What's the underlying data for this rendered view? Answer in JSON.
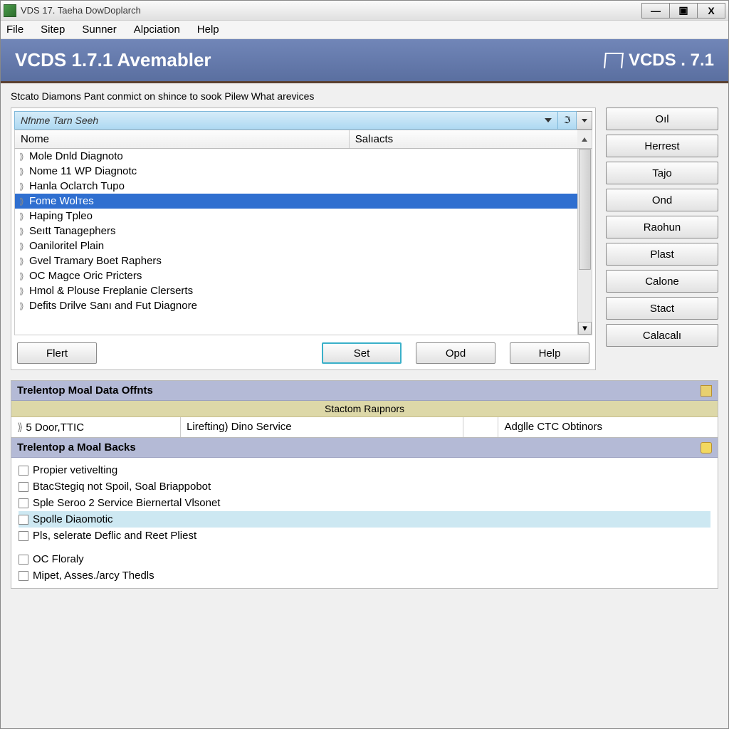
{
  "titlebar": {
    "text": "VDS 17. Taeha DowDoplarch"
  },
  "menubar": {
    "items": [
      "File",
      "Sitep",
      "Sunner",
      "Alpciation",
      "Help"
    ]
  },
  "header": {
    "title": "VCDS 1.7.1 Avemabler",
    "right": "VCDS . 7.1"
  },
  "instruction": "Stcato Diamons Pant conmict on shince to sook Pilew What arevices",
  "dropdown": {
    "text": "Nfnme Tarn Seeh",
    "extra": "ℑ"
  },
  "list": {
    "headers": {
      "c1": "Nome",
      "c2": "Salıacts"
    },
    "items": [
      "Mole Dnld Diagnoto",
      "Nome 11 WP Diagnotc",
      "Hanla Oclатсh Tupo",
      "Fome Wolтes",
      "Haping Tpleo",
      "Seıtt Tanageрhers",
      "Oaniloritel Plain",
      "Gvel Tramary Boet Raphers",
      "OC Magсe Oric Priсters",
      "Hmol & Plouse Freplanie Clerserts",
      "Defits Drilve Sanı and Fut Diagnоre"
    ],
    "selectedIndex": 3
  },
  "buttons": {
    "flert": "Flert",
    "set": "Set",
    "opd": "Opd",
    "help": "Help"
  },
  "side_buttons": [
    "Oıl",
    "Herrest",
    "Tajo",
    "Ond",
    "Raohun",
    "Plast",
    "Calone",
    "Stact",
    "Calaсalı"
  ],
  "panel1": {
    "title": "Trelentop Moal Data Offnts",
    "sub": "Stactom Raıpnors",
    "cells": [
      "5 Door,TTIC",
      "Lirefting) Dino Service",
      "",
      "Adglle CTC Obtinors"
    ]
  },
  "panel2": {
    "title": "Trelentop a Moal Backs",
    "checks": [
      {
        "label": "Propier vetivelting",
        "hl": false
      },
      {
        "label": "BtacStegiq not Spoil, Soal Briappobot",
        "hl": false
      },
      {
        "label": "Sple Seroo 2 Service Biernertal Vlsonet",
        "hl": false
      },
      {
        "label": "Spolle Diaomotic",
        "hl": true
      },
      {
        "label": "Pls, selerate Deflic and Reet Pliest",
        "hl": false
      }
    ],
    "checks2": [
      {
        "label": "OC Floraly"
      },
      {
        "label": "Mipet, Asses./arcy Thedls"
      }
    ]
  }
}
